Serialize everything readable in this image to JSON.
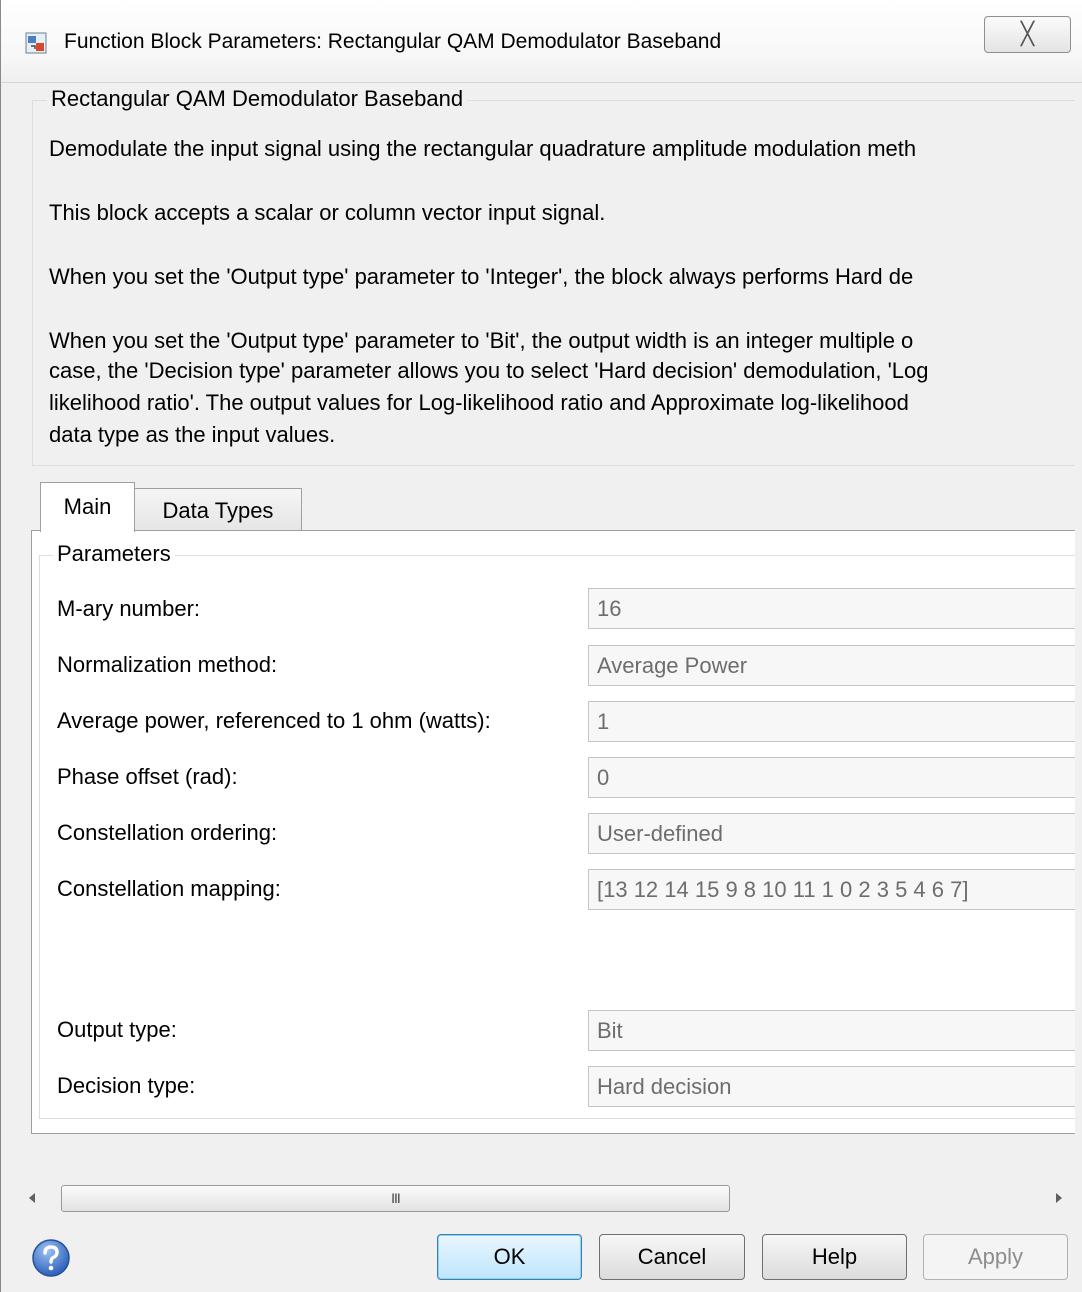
{
  "window": {
    "title": "Function Block Parameters: Rectangular QAM Demodulator Baseband",
    "close_glyph": "╳"
  },
  "description": {
    "group_title": "Rectangular QAM Demodulator Baseband",
    "lines": [
      "Demodulate the input signal using the rectangular quadrature amplitude modulation meth",
      "This block accepts a scalar or column vector input signal.",
      "When you set the 'Output type' parameter to 'Integer', the block always performs Hard de",
      "When you set the 'Output type' parameter to 'Bit', the output width is an integer multiple o",
      "case, the 'Decision type' parameter allows you to select 'Hard decision' demodulation, 'Log",
      "likelihood ratio'. The output values for Log-likelihood ratio and Approximate log-likelihood",
      "data type as the input values."
    ]
  },
  "tabs": [
    {
      "label": "Main",
      "selected": true
    },
    {
      "label": "Data Types",
      "selected": false
    }
  ],
  "parameters": {
    "group_title": "Parameters",
    "rows": [
      {
        "label": "M-ary number:",
        "value": "16"
      },
      {
        "label": "Normalization method:",
        "value": "Average Power"
      },
      {
        "label": "Average power, referenced to 1 ohm (watts):",
        "value": "1"
      },
      {
        "label": "Phase offset (rad):",
        "value": "0"
      },
      {
        "label": "Constellation ordering:",
        "value": "User-defined"
      },
      {
        "label": "Constellation mapping:",
        "value": "[13 12 14 15 9 8 10 11 1 0 2 3 5 4 6 7]"
      },
      {
        "label": "Output type:",
        "value": "Bit"
      },
      {
        "label": "Decision type:",
        "value": "Hard decision"
      }
    ]
  },
  "scrollbar": {
    "thumb_grip": "III"
  },
  "buttons": {
    "ok": "OK",
    "cancel": "Cancel",
    "help": "Help",
    "apply": "Apply"
  },
  "colors": {
    "help_icon": "#3a6fc8",
    "ok_border": "#3c7fb1"
  }
}
